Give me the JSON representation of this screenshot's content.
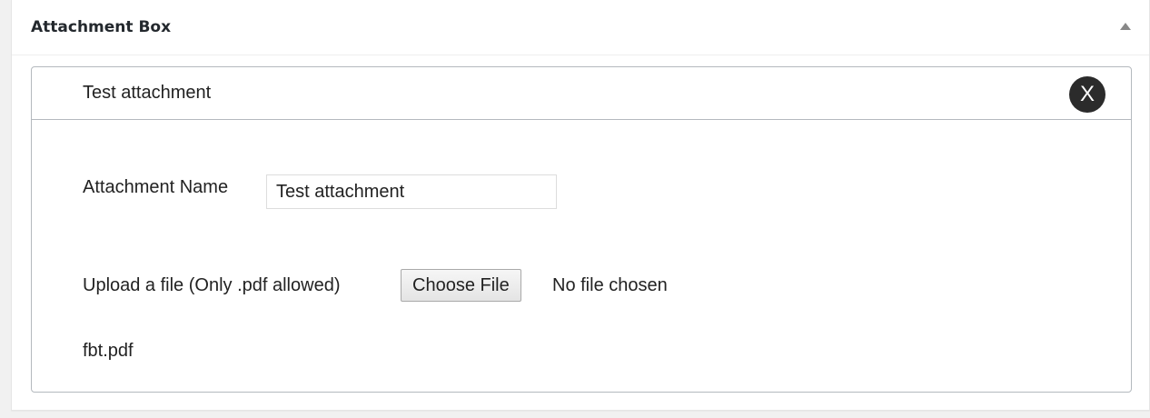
{
  "metabox": {
    "title": "Attachment Box",
    "toggle_icon": "triangle-up-icon"
  },
  "attachment": {
    "header_title": "Test attachment",
    "remove_label": "X",
    "name_label": "Attachment Name",
    "name_value": "Test attachment",
    "upload_label": "Upload a file (Only .pdf allowed)",
    "choose_file_label": "Choose File",
    "no_file_text": "No file chosen",
    "existing_file": "fbt.pdf"
  },
  "colors": {
    "remove_button_bg": "#2b2b2b",
    "card_border": "#b4b9be",
    "page_bg": "#f1f1f1"
  }
}
